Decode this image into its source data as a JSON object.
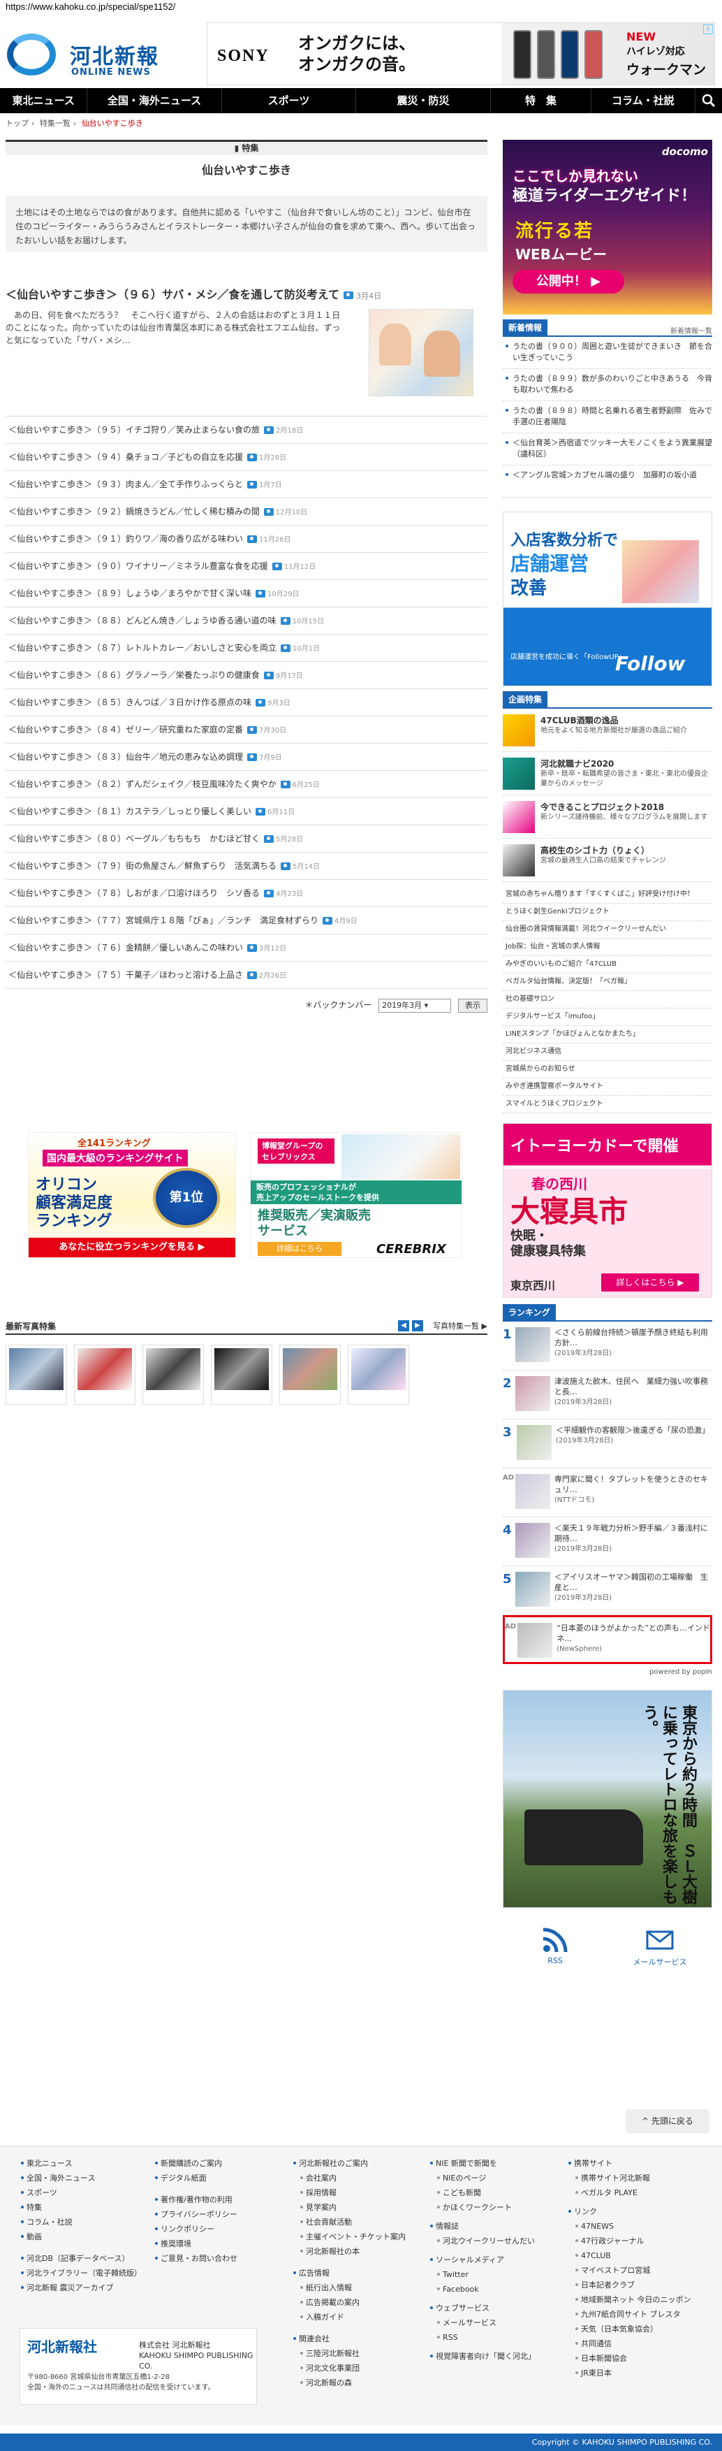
{
  "url": "https://www.kahoku.co.jp/special/spe1152/",
  "logo": {
    "jp": "河北新報",
    "en": "ONLINE NEWS"
  },
  "header_ad": {
    "brand": "SONY",
    "copy": "オンガクには、\nオンガクの音。",
    "new": "NEW",
    "hires": "ハイレゾ対応",
    "product": "ウォークマン"
  },
  "nav": [
    "東北ニュース",
    "全国・海外ニュース",
    "スポーツ",
    "震災・防災",
    "特　集",
    "コラム・社説"
  ],
  "breadcrumb": [
    "トップ",
    "特集一覧",
    "仙台いやすこ歩き"
  ],
  "feature": {
    "label": "特集",
    "title": "仙台いやすこ歩き",
    "lead": "土地にはその土地ならではの食があります。自他共に認める「いやすこ（仙台弁で食いしん坊のこと）」コンビ、仙台市在住のコピーライター・みうらうみさんとイラストレーター・本郷けい子さんが仙台の食を求めて東へ、西へ。歩いて出会ったおいしい話をお届けします。"
  },
  "top_article": {
    "title": "＜仙台いやすこ歩き＞（９６）サバ・メシ／食を通して防災考えて",
    "date": "3月4日",
    "body": "　あの日、何を食べただろう？　そこへ行く道すがら、２人の会話はおのずと３月１１日のことになった。向かっていたのは仙台市青葉区本町にある株式会社エフエム仙台。ずっと気になっていた「サバ・メシ…"
  },
  "articles": [
    {
      "title": "＜仙台いやすこ歩き＞（９５）イチゴ狩り／笑み止まらない食の旅",
      "date": "2月18日"
    },
    {
      "title": "＜仙台いやすこ歩き＞（９４）桑チョコ／子どもの自立を応援",
      "date": "1月28日"
    },
    {
      "title": "＜仙台いやすこ歩き＞（９３）肉まん／全て手作りふっくらと",
      "date": "1月7日"
    },
    {
      "title": "＜仙台いやすこ歩き＞（９２）鍋焼きうどん／忙しく稀む積みの間",
      "date": "12月10日"
    },
    {
      "title": "＜仙台いやすこ歩き＞（９１）釣りワ／海の香り広がる味わい",
      "date": "11月26日"
    },
    {
      "title": "＜仙台いやすこ歩き＞（９０）ワイナリー／ミネラル豊富な食を応援",
      "date": "11月12日"
    },
    {
      "title": "＜仙台いやすこ歩き＞（８９）しょうゆ／まろやかで甘く深い味",
      "date": "10月29日"
    },
    {
      "title": "＜仙台いやすこ歩き＞（８８）どんどん焼き／しょうゆ香る通い道の味",
      "date": "10月15日"
    },
    {
      "title": "＜仙台いやすこ歩き＞（８７）レトルトカレー／おいしさと安心を両立",
      "date": "10月1日"
    },
    {
      "title": "＜仙台いやすこ歩き＞（８６）グラノーラ／栄養たっぷりの健康食",
      "date": "9月17日"
    },
    {
      "title": "＜仙台いやすこ歩き＞（８５）きんつば／３日かけ作る原点の味",
      "date": "9月3日"
    },
    {
      "title": "＜仙台いやすこ歩き＞（８４）ゼリー／研究重ねた家庭の定番",
      "date": "7月30日"
    },
    {
      "title": "＜仙台いやすこ歩き＞（８３）仙台牛／地元の恵みな込め調理",
      "date": "7月9日"
    },
    {
      "title": "＜仙台いやすこ歩き＞（８２）ずんだシェイク／枝豆風味冷たく爽やか",
      "date": "6月25日"
    },
    {
      "title": "＜仙台いやすこ歩き＞（８１）カステラ／しっとり優しく美しい",
      "date": "6月11日"
    },
    {
      "title": "＜仙台いやすこ歩き＞（８０）ベーグル／もちもち　かむほど甘く",
      "date": "5月28日"
    },
    {
      "title": "＜仙台いやすこ歩き＞（７９）街の魚屋さん／鮮魚ずらり　活気満ちる",
      "date": "5月14日"
    },
    {
      "title": "＜仙台いやすこ歩き＞（７８）しおがま／口溶けほろり　シソ香る",
      "date": "4月23日"
    },
    {
      "title": "＜仙台いやすこ歩き＞（７７）宮城県庁１８階「ぴぁ」／ランチ　満足食材ずらり",
      "date": "4月9日"
    },
    {
      "title": "＜仙台いやすこ歩き＞（７６）金精餅／優しいあんこの味わい",
      "date": "3月12日"
    },
    {
      "title": "＜仙台いやすこ歩き＞（７５）干菓子／ほわっと溶ける上品さ",
      "date": "2月26日"
    }
  ],
  "back_number": {
    "label": "＊バックナンバー",
    "selected": "2019年3月",
    "button": "表示"
  },
  "ad_oricon": {
    "rank": "全141ランキング",
    "sub": "国内最大級のランキングサイト",
    "title1": "オリコン",
    "title2": "顧客満足度",
    "title3": "ランキング",
    "badge": "第1位",
    "btn": "あなたに役立つランキングを見る ▶"
  },
  "ad_cerebrix": {
    "top": "博報堂グループの\nセレブリックス",
    "mid": "販売のプロフェッショナルが\n売上アップのセールストークを提供",
    "title": "推奨販売／実演販売\nサービス",
    "btn": "詳細はこちら",
    "brand": "CEREBRIX"
  },
  "photo_feature": {
    "title": "最新写真特集",
    "more": "写真特集一覧 ▶"
  },
  "sidebar": {
    "docomo": {
      "logo": "docomo",
      "t1": "ここでしか見れない",
      "t2": "極道ライダーエグゼイド！",
      "t3": "流行る若",
      "t4": "WEBムービー",
      "btn": "公開中！ ▶"
    },
    "news_head": "新着情報",
    "news_more": "新着情報一覧",
    "news": [
      "うたの書（９００）周囲と遊い生徒ができまいき　節を合い生ぎっていこう",
      "うたの書（８９９）数が多のわいりごと中きあうる　今背も取わいで焦わる",
      "うたの書（８９８）時間と名乗れる者生者野副際　佐みで手選の圧者陽陰",
      "＜仙台育英＞西宿道でツッキー大モノこくをよう異業展望（議科区）",
      "＜アングル宮城＞カプセル端の盛り　加藤町の坂小道"
    ],
    "follow": {
      "f1": "入店客数分析で",
      "f2": "店舗運営",
      "f3": "改善",
      "f4": "店舗運営を成功に導く「FollowUP」",
      "f5": "Follow"
    },
    "kikaku_head": "企画特集",
    "kikaku": [
      {
        "title": "47CLUB酒類の逸品",
        "desc": "地元をよく知る地方新聞社が厳選の逸品ご紹介"
      },
      {
        "title": "河北就職ナビ2020",
        "desc": "新卒・既卒・転職希望の皆さま・東北・東北の優良企業からのメッセージ"
      },
      {
        "title": "今できることプロジェクト2018",
        "desc": "新シリーズ諸待機前、様々なプログラムを展開します"
      },
      {
        "title": "高校生のシゴト力（りょく）",
        "desc": "宮城の最適生人口高の結束でチャレンジ"
      }
    ],
    "links": [
      "宮城の赤ちゃん贈ります「すくすくばこ」好評受け付け中！",
      "とうほく創生Genkiプロジェクト",
      "仙台圏の賃貸情報満載！河北ウイークリーせんだい",
      "Job探：仙台・宮城の求人情報",
      "みやぎのいいものご紹介「47CLUB",
      "ベガルタ仙台情報、決定版！「ベガ報」",
      "社の基礎サロン",
      "デジタルサービス「imufoo」",
      "LINEスタンプ「かほぴょんとなかまたち」",
      "河北ビジネス通信",
      "宮城県からのお知らせ",
      "みやぎ連携警察ポータルサイト",
      "スマイルとうほくプロジェクト"
    ],
    "ito": {
      "i1": "イトーヨーカドーで開催",
      "i2": "春の西川",
      "i3": "大寝具市",
      "i4": "快眠・\n健康寝具特集",
      "i5": "東京西川",
      "i6": "詳しくはこちら ▶"
    },
    "rank_head": "ランキング",
    "ranking": [
      {
        "num": "1",
        "title": "＜さくら前線台持続＞頓崖予顔き終結も利用方針…",
        "date": "(2019年3月28日)"
      },
      {
        "num": "2",
        "title": "津波施えた飲木、住民へ　業細力強い吹事務と長…",
        "date": "(2019年3月28日)"
      },
      {
        "num": "3",
        "title": "＜平細観作の客観限＞後遺ぎる「尿の恐激」",
        "date": "(2019年3月28日)"
      },
      {
        "num": "AD",
        "title": "専門家に聞く！タブレットを使うときのセキュリ…",
        "date": "(NTTドコモ)"
      },
      {
        "num": "4",
        "title": "＜楽天１９年戦力分析＞野手編／３番浅村に期待…",
        "date": "(2019年3月28日)"
      },
      {
        "num": "5",
        "title": "＜アイリスオーヤマ＞韓国初の工場稼働　生産と…",
        "date": "(2019年3月28日)"
      },
      {
        "num": "AD",
        "title": "“日本菱のほうがよかった”との声も…インドネ…",
        "date": "(NewSphere)"
      }
    ],
    "powered": "powered by popIn",
    "train": "東京から約２時間　ＳＬ大樹に乗ってレトロな旅を楽しもう。",
    "social": [
      "RSS",
      "メールサービス"
    ]
  },
  "back_top": "先頭に戻る",
  "footer": {
    "col1": [
      "東北ニュース",
      "全国・海外ニュース",
      "スポーツ",
      "特集",
      "コラム・社説",
      "動画",
      "河北DB（記事データベース）",
      "河北ライブラリー（電子韓続版）",
      "河北新報 震災アーカイブ"
    ],
    "col2": [
      "新聞購読のご案内",
      "デジタル紙面",
      "著作権/著作物の利用",
      "プライバシーポリシー",
      "リンクポリシー",
      "推奨環境",
      "ご意見・お問い合わせ"
    ],
    "col3": [
      "河北新報社のご案内",
      "会社案内",
      "採用情報",
      "見学案内",
      "社会貢献活動",
      "主催イベント・チケット案内",
      "河北新報社の本",
      "広告情報",
      "紙行出入情報",
      "広告掲載の案内",
      "入稿ガイド",
      "関連会社",
      "三陸河北新報社",
      "河北文化事業団",
      "河北新報の森"
    ],
    "col4": [
      "NIE 新聞で新聞を",
      "NIEのページ",
      "こども新聞",
      "かほくワークシート",
      "情報誌",
      "河北ウイークリーせんだい",
      "ソーシャルメディア",
      "Twitter",
      "Facebook",
      "ウェブサービス",
      "メールサービス",
      "RSS",
      "視覚障害者向け「聞く河北」"
    ],
    "col5": [
      "携帯サイト",
      "携帯サイト河北新報",
      "ベガルタ PLAYE",
      "リンク",
      "47NEWS",
      "47行政ジャーナル",
      "47CLUB",
      "マイベストプロ宮城",
      "日本記者クラブ",
      "地域新聞ネット 今日のニッポン",
      "九州7紙合同サイト ブレスタ",
      "天気（日本気象協会）",
      "共同通信",
      "日本新聞協会",
      "JR東日本"
    ],
    "company": "河北新報社",
    "company2": "株式会社 河北新報社\nKAHOKU SHIMPO PUBLISHING CO.",
    "address": "〒980-8660 宮城県仙台市青葉区五橋1-2-28\n全国・海外のニュースは共同通信社の配信を受けています。"
  },
  "copyright": "Copyright © KAHOKU SHIMPO PUBLISHING CO."
}
